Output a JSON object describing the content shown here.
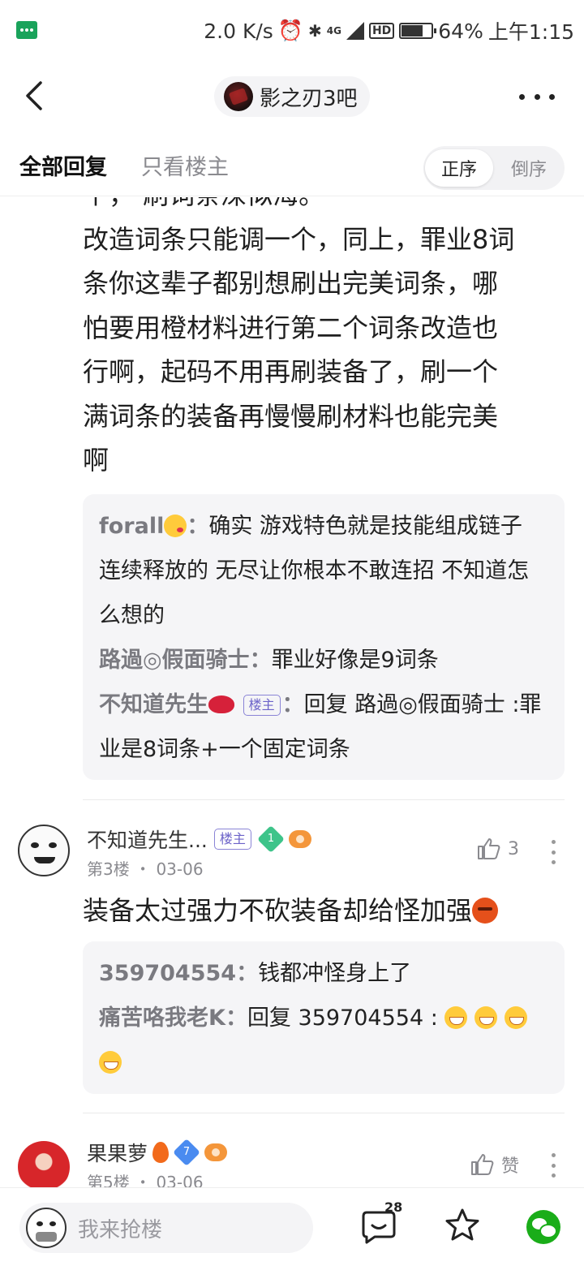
{
  "status_bar": {
    "network_speed": "2.0 K/s",
    "network_type": "4G",
    "hd_label": "HD",
    "battery": "64%",
    "time": "上午1:15"
  },
  "header": {
    "forum_name": "影之刃3吧"
  },
  "tabs": {
    "all_replies": "全部回复",
    "owner_only": "只看楼主",
    "sort_asc": "正序",
    "sort_desc": "倒序"
  },
  "floor2": {
    "partial_line": "个，    刷词条深似海。",
    "lines": [
      "改造词条只能调一个，同上，罪业8词",
      "条你这辈子都别想刷出完美词条，哪",
      "怕要用橙材料进行第二个词条改造也",
      "行啊，起码不用再刷装备了，刷一个",
      "满词条的装备再慢慢刷材料也能完美",
      "啊"
    ],
    "replies": [
      {
        "user": "forall",
        "text": "确实 游戏特色就是技能组成链子 连续释放的 无尽让你根本不敢连招 不知道怎么想的"
      },
      {
        "user": "路過◎假面骑士",
        "text": "罪业好像是9词条"
      },
      {
        "user": "不知道先生",
        "tag": "楼主",
        "text": "回复 路過◎假面骑士 :罪业是8词条+一个固定词条"
      }
    ]
  },
  "floor3": {
    "username": "不知道先生...",
    "tag": "楼主",
    "level": "1",
    "floor": "第3楼",
    "date": "03-06",
    "likes": "3",
    "body": "装备太过强力不砍装备却给怪加强",
    "replies": [
      {
        "user": "359704554",
        "text": "钱都冲怪身上了"
      },
      {
        "user": "痛苦咯我老K",
        "text": "回复 359704554 :"
      }
    ]
  },
  "floor5": {
    "username": "果果萝",
    "level": "7",
    "floor": "第5楼",
    "date": "03-06",
    "like_label": "赞"
  },
  "bottom_bar": {
    "placeholder": "我来抢楼",
    "comment_count": "28"
  },
  "icons": {
    "back": "back-arrow-icon",
    "more": "more-dots-icon",
    "like": "thumb-up-icon",
    "comment": "comment-icon",
    "favorite": "star-icon",
    "share": "wechat-icon"
  },
  "colors": {
    "accent_tag": "#6c63c9",
    "reply_bg": "#f5f5f7",
    "wechat_green": "#1aad19"
  }
}
